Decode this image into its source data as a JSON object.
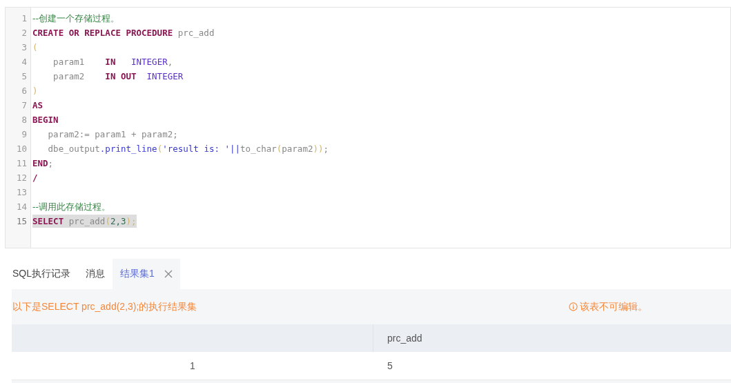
{
  "editor": {
    "lines": [
      {
        "number": "1",
        "highlighted": false,
        "tokens": [
          {
            "text": "--创建一个存储过程。",
            "kind": "comment"
          }
        ]
      },
      {
        "number": "2",
        "highlighted": false,
        "tokens": [
          {
            "text": "CREATE OR REPLACE PROCEDURE",
            "kind": "keyword"
          },
          {
            "text": " prc_add",
            "kind": "name"
          }
        ]
      },
      {
        "number": "3",
        "highlighted": false,
        "tokens": [
          {
            "text": "(",
            "kind": "paren"
          }
        ]
      },
      {
        "number": "4",
        "highlighted": false,
        "tokens": [
          {
            "text": "    param1    ",
            "kind": "name"
          },
          {
            "text": "IN",
            "kind": "keyword"
          },
          {
            "text": "   INTEGER",
            "kind": "type"
          },
          {
            "text": ",",
            "kind": "name"
          }
        ]
      },
      {
        "number": "5",
        "highlighted": false,
        "tokens": [
          {
            "text": "    param2    ",
            "kind": "name"
          },
          {
            "text": "IN OUT",
            "kind": "keyword"
          },
          {
            "text": "  INTEGER",
            "kind": "type"
          }
        ]
      },
      {
        "number": "6",
        "highlighted": false,
        "tokens": [
          {
            "text": ")",
            "kind": "paren"
          }
        ]
      },
      {
        "number": "7",
        "highlighted": false,
        "tokens": [
          {
            "text": "AS",
            "kind": "keyword"
          }
        ]
      },
      {
        "number": "8",
        "highlighted": false,
        "tokens": [
          {
            "text": "BEGIN",
            "kind": "keyword"
          }
        ]
      },
      {
        "number": "9",
        "highlighted": false,
        "tokens": [
          {
            "text": "   param2:= param1 + param2;",
            "kind": "name"
          }
        ]
      },
      {
        "number": "10",
        "highlighted": false,
        "tokens": [
          {
            "text": "   dbe_output",
            "kind": "name"
          },
          {
            "text": ".print_line",
            "kind": "function"
          },
          {
            "text": "(",
            "kind": "paren"
          },
          {
            "text": "'result is: '",
            "kind": "string"
          },
          {
            "text": "||",
            "kind": "function"
          },
          {
            "text": "to_char",
            "kind": "name"
          },
          {
            "text": "(",
            "kind": "paren"
          },
          {
            "text": "param2",
            "kind": "name"
          },
          {
            "text": "))",
            "kind": "paren"
          },
          {
            "text": ";",
            "kind": "name"
          }
        ]
      },
      {
        "number": "11",
        "highlighted": false,
        "tokens": [
          {
            "text": "END",
            "kind": "keyword"
          },
          {
            "text": ";",
            "kind": "name"
          }
        ]
      },
      {
        "number": "12",
        "highlighted": false,
        "tokens": [
          {
            "text": "/",
            "kind": "keyword"
          }
        ]
      },
      {
        "number": "13",
        "highlighted": false
      },
      {
        "number": "14",
        "highlighted": false,
        "tokens": [
          {
            "text": "--调用此存储过程。",
            "kind": "comment"
          }
        ]
      },
      {
        "number": "15",
        "highlighted": true,
        "tokens": [
          {
            "text": "SELECT",
            "kind": "keyword"
          },
          {
            "text": " prc_add",
            "kind": "name"
          },
          {
            "text": "(",
            "kind": "paren"
          },
          {
            "text": "2,3",
            "kind": "number"
          },
          {
            "text": ");",
            "kind": "paren"
          }
        ]
      }
    ]
  },
  "tabs": [
    {
      "label": "SQL执行记录",
      "selected": false,
      "closable": false
    },
    {
      "label": "消息",
      "selected": false,
      "closable": false
    },
    {
      "label": "结果集1",
      "selected": true,
      "closable": true
    }
  ],
  "result": {
    "caption": "以下是SELECT prc_add(2,3);的执行结果集",
    "notice": "该表不可编辑。",
    "table": {
      "columns": [
        "",
        "prc_add"
      ],
      "rows": [
        [
          "1",
          "5"
        ]
      ]
    }
  }
}
